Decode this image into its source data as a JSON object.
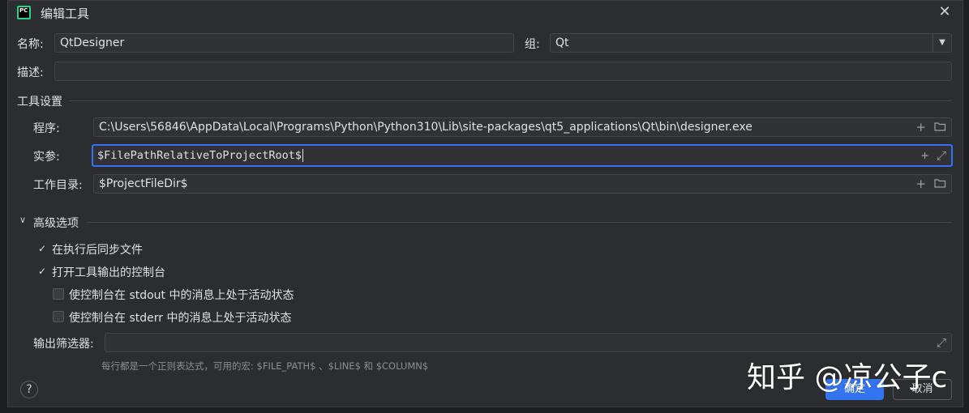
{
  "window": {
    "app_icon": "pycharm-icon",
    "app_icon_text": "PC",
    "title": "编辑工具",
    "close_glyph": "✕"
  },
  "form": {
    "name_label": "名称:",
    "name_value": "QtDesigner",
    "group_label": "组:",
    "group_value": "Qt",
    "description_label": "描述:",
    "description_value": ""
  },
  "tool_settings": {
    "section_title": "工具设置",
    "program_label": "程序:",
    "program_value": "C:\\Users\\56846\\AppData\\Local\\Programs\\Python\\Python310\\Lib\\site-packages\\qt5_applications\\Qt\\bin\\designer.exe",
    "arguments_label": "实参:",
    "arguments_value": "$FilePathRelativeToProjectRoot$",
    "workdir_label": "工作目录:",
    "workdir_value": "$ProjectFileDir$"
  },
  "advanced": {
    "section_title": "高级选项",
    "expanded": true,
    "options": [
      {
        "label": "在执行后同步文件",
        "checked": true
      },
      {
        "label": "打开工具输出的控制台",
        "checked": true
      },
      {
        "label": "使控制台在 stdout 中的消息上处于活动状态",
        "checked": false
      },
      {
        "label": "使控制台在 stderr 中的消息上处于活动状态",
        "checked": false
      }
    ],
    "output_filter_label": "输出筛选器:",
    "output_filter_value": "",
    "hint": "每行都是一个正则表达式，可用的宏: $FILE_PATH$ 、$LINE$ 和 $COLUMN$"
  },
  "footer": {
    "help_label": "?",
    "ok_label": "确定",
    "cancel_label": "取消"
  },
  "watermark": "知乎 @凉公子c",
  "colors": {
    "background": "#2b2d30",
    "accent": "#3574f0",
    "field_border": "#43454a",
    "text": "#dfe1e5"
  }
}
